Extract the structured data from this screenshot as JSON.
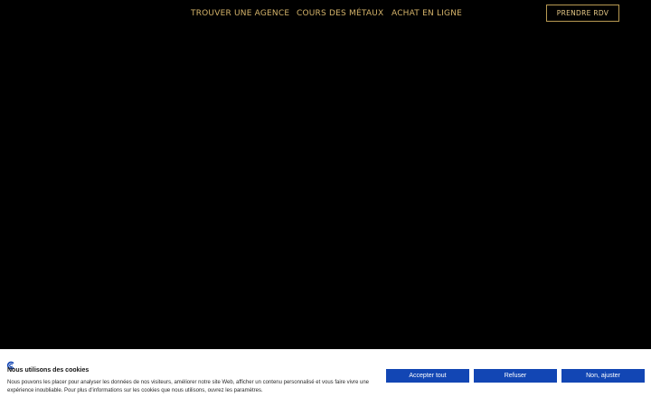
{
  "nav": {
    "links": [
      {
        "label": "TROUVER UNE AGENCE"
      },
      {
        "label": "COURS DES MÉTAUX"
      },
      {
        "label": "ACHAT EN LIGNE"
      }
    ],
    "cta_label": "PRENDRE RDV"
  },
  "cookie_banner": {
    "title": "Nous utilisons des cookies",
    "text": "Nous pouvons les placer pour analyser les données de nos visiteurs, améliorer notre site Web, afficher un contenu personnalisé et vous faire vivre une expérience inoubliable. Pour plus d'informations sur les cookies que nous utilisons, ouvrez les paramètres.",
    "accept_label": "Accepter tout",
    "refuse_label": "Refuser",
    "adjust_label": "Non, ajuster",
    "logo_icon": "cookie-consent-logo-icon"
  },
  "colors": {
    "background": "#000000",
    "nav_gold": "#d4b36a",
    "button_blue": "#1246b4",
    "banner_bg": "#ffffff"
  }
}
